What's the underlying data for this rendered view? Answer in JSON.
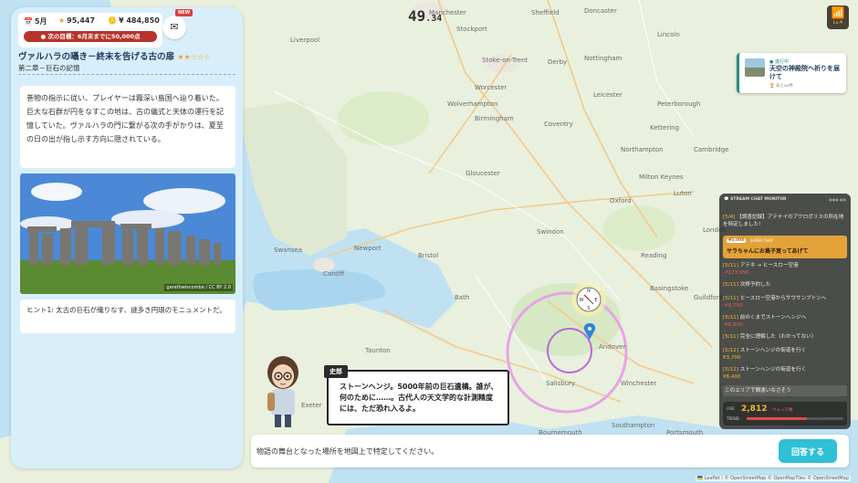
{
  "timer": {
    "seconds": "49",
    "fraction": ".34"
  },
  "header": {
    "month": "5月",
    "stars": "95,447",
    "money": "¥ 484,850",
    "goal": "次の目標：6月末までに50,000点",
    "new_badge": "NEW"
  },
  "quest": {
    "title": "ヴァルハラの囁き－終末を告げる古の扉",
    "stars": "★★☆☆☆",
    "chapter": "第二章－巨石の記憶",
    "story": "巻物の指示に従い、プレイヤーは霧深い島国へ辿り着いた。巨大な石群が円をなすこの地は、古の儀式と天体の運行を記憶していた。ヴァルハラの門に繋がる次の手がかりは、夏至の日の出が指し示す方向に隠されている。",
    "photo_credit": "garethwiscombe / CC BY 2.0",
    "hint": "ヒント1: 太古の巨石が織りなす、謎多き円環のモニュメントだ。"
  },
  "character": {
    "name": "史郎",
    "speech": "ストーンヘンジ。5000年前の巨石遺構。誰が、何のために……。古代人の天文学的な計測精度には、ただ恐れ入るよ。"
  },
  "notification": {
    "status": "● 進行中",
    "title": "天空の神殿院へ祈りを届けて",
    "reward": "🏆 あとxx件"
  },
  "wifi": {
    "icon": "wifi-icon",
    "level": "Lv.4"
  },
  "chat": {
    "header": "STREAM CHAT MONITOR",
    "header_right": "●●● ●●",
    "m1_tag": "[5/4]",
    "m1_text": "【調査記録】アテナイのアクロポリスの所在地を特定しました!",
    "sc_amount": "¥5,000",
    "sc_label": "SUPER CHAT",
    "sc_text": "サラちゃんにお菓子買ってあげて",
    "m2_tag": "[5/11]",
    "m2_text": "アテネ → ヒースロー空港",
    "m2_money": "-¥173,590",
    "m3_tag": "[5/11]",
    "m3_text": "次移予約した",
    "m4_tag": "[5/11]",
    "m4_text": "ヒースロー空港からサウサンプトンへ",
    "m4_money": "-¥9,750",
    "m5_tag": "[5/11]",
    "m5_text": "前のくまでストーンヘンジへ",
    "m5_money": "-¥6,800",
    "m6_tag": "[5/11]",
    "m6_text": "完全に理解した（わかってない）",
    "m7_tag": "[5/12]",
    "m7_text": "ストーンヘンジの街道を行く",
    "m7_money": "¥3,700",
    "m8_tag": "[5/12]",
    "m8_text": "ストーンヘンジの街道を行く",
    "m8_money": "¥8,400",
    "m9_text": "このエリアで間違いなさそう",
    "live_label1": "LIVE",
    "live_label2": "TREND",
    "viewers": "2,812",
    "viewers_unit": "ウォッチ数",
    "live_progress": 0.62
  },
  "answer": {
    "placeholder": "物語の舞台となった場所を地図上で特定してください。",
    "button": "回答する"
  },
  "map": {
    "places": [
      "Liverpool",
      "Sheffield",
      "Doncaster",
      "Lincoln",
      "Manchester",
      "Stockport",
      "Stoke-on-Trent",
      "Nottingham",
      "Derby",
      "Leicester",
      "Wolverhampton",
      "Birmingham",
      "Coventry",
      "Peterborough",
      "Northampton",
      "Kettering",
      "Worcester",
      "Milton Keynes",
      "Luton",
      "Cambridge",
      "Gloucester",
      "Swindon",
      "Oxford",
      "Bristol",
      "Newport",
      "Cardiff",
      "Swansea",
      "Reading",
      "London",
      "Bath",
      "Basingstoke",
      "Salisbury",
      "Andover",
      "Winchester",
      "Southampton",
      "Bournemouth",
      "Exeter",
      "Taunton",
      "Guildford",
      "Portsmouth"
    ],
    "attribution": "🇺🇦 Leaflet | © OpenStreetMap © OpenMapTiles © OpenStreetMap"
  }
}
